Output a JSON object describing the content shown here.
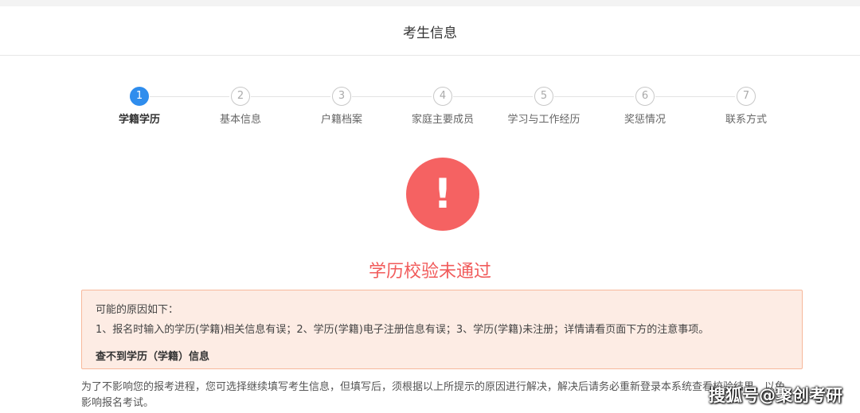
{
  "header": {
    "title": "考生信息"
  },
  "steps": [
    {
      "number": "1",
      "label": "学籍学历"
    },
    {
      "number": "2",
      "label": "基本信息"
    },
    {
      "number": "3",
      "label": "户籍档案"
    },
    {
      "number": "4",
      "label": "家庭主要成员"
    },
    {
      "number": "5",
      "label": "学习与工作经历"
    },
    {
      "number": "6",
      "label": "奖惩情况"
    },
    {
      "number": "7",
      "label": "联系方式"
    }
  ],
  "current_step": 1,
  "status": {
    "icon": "exclamation-icon",
    "icon_glyph": "!",
    "title": "学历校验未通过",
    "color": "#f56262"
  },
  "reasons": {
    "heading": "可能的原因如下：",
    "text": "1、报名时输入的学历(学籍)相关信息有误；2、学历(学籍)电子注册信息有误；3、学历(学籍)未注册；详情请看页面下方的注意事项。",
    "link": "查不到学历（学籍）信息"
  },
  "notice": "为了不影响您的报考进程，您可选择继续填写考生信息，但填写后，须根据以上所提示的原因进行解决，解决后请务必重新登录本系统查看校验结果，以免影响报名考试。",
  "watermark": "搜狐号@聚创考研",
  "colors": {
    "accent": "#2f8ded",
    "error": "#f15b5b",
    "alert_bg": "#fdece4",
    "alert_border": "#f7b89b"
  }
}
